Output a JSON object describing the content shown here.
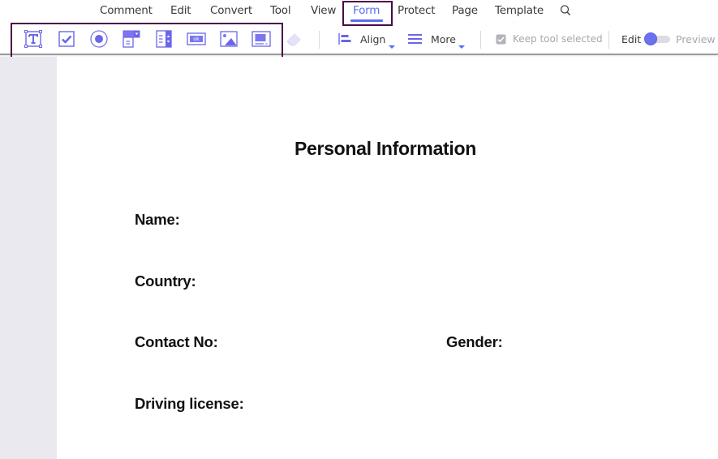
{
  "menu": {
    "items": [
      {
        "label": "Comment"
      },
      {
        "label": "Edit"
      },
      {
        "label": "Convert"
      },
      {
        "label": "Tool"
      },
      {
        "label": "View"
      },
      {
        "label": "Form",
        "active": true
      },
      {
        "label": "Protect"
      },
      {
        "label": "Page"
      },
      {
        "label": "Template"
      }
    ],
    "search_icon": "search-icon"
  },
  "toolbar": {
    "form_tools": [
      {
        "name": "text-field-tool",
        "icon": "text-field-icon"
      },
      {
        "name": "checkbox-tool",
        "icon": "checkbox-icon"
      },
      {
        "name": "radio-button-tool",
        "icon": "radio-button-icon"
      },
      {
        "name": "combo-box-tool",
        "icon": "combo-box-icon"
      },
      {
        "name": "list-box-tool",
        "icon": "list-box-icon"
      },
      {
        "name": "button-tool",
        "icon": "button-icon",
        "glyph": "ok"
      },
      {
        "name": "image-field-tool",
        "icon": "image-icon"
      },
      {
        "name": "signature-field-tool",
        "icon": "signature-field-icon"
      },
      {
        "name": "eraser-tool",
        "icon": "eraser-icon",
        "disabled": true
      }
    ],
    "align_label": "Align",
    "more_label": "More",
    "keep_tool_selected_label": "Keep tool selected",
    "keep_tool_selected_checked": true,
    "mode_edit_label": "Edit",
    "mode_preview_label": "Preview",
    "mode": "Edit"
  },
  "colors": {
    "accent": "#5a6cf0",
    "highlight_box": "#4a0a47",
    "gutter": "#e9e9ef"
  },
  "document": {
    "title": "Personal Information",
    "fields": [
      {
        "label": "Name:"
      },
      {
        "label": "Country:"
      },
      {
        "label": "Contact No:"
      },
      {
        "label": "Gender:"
      },
      {
        "label": "Driving license:"
      }
    ]
  }
}
